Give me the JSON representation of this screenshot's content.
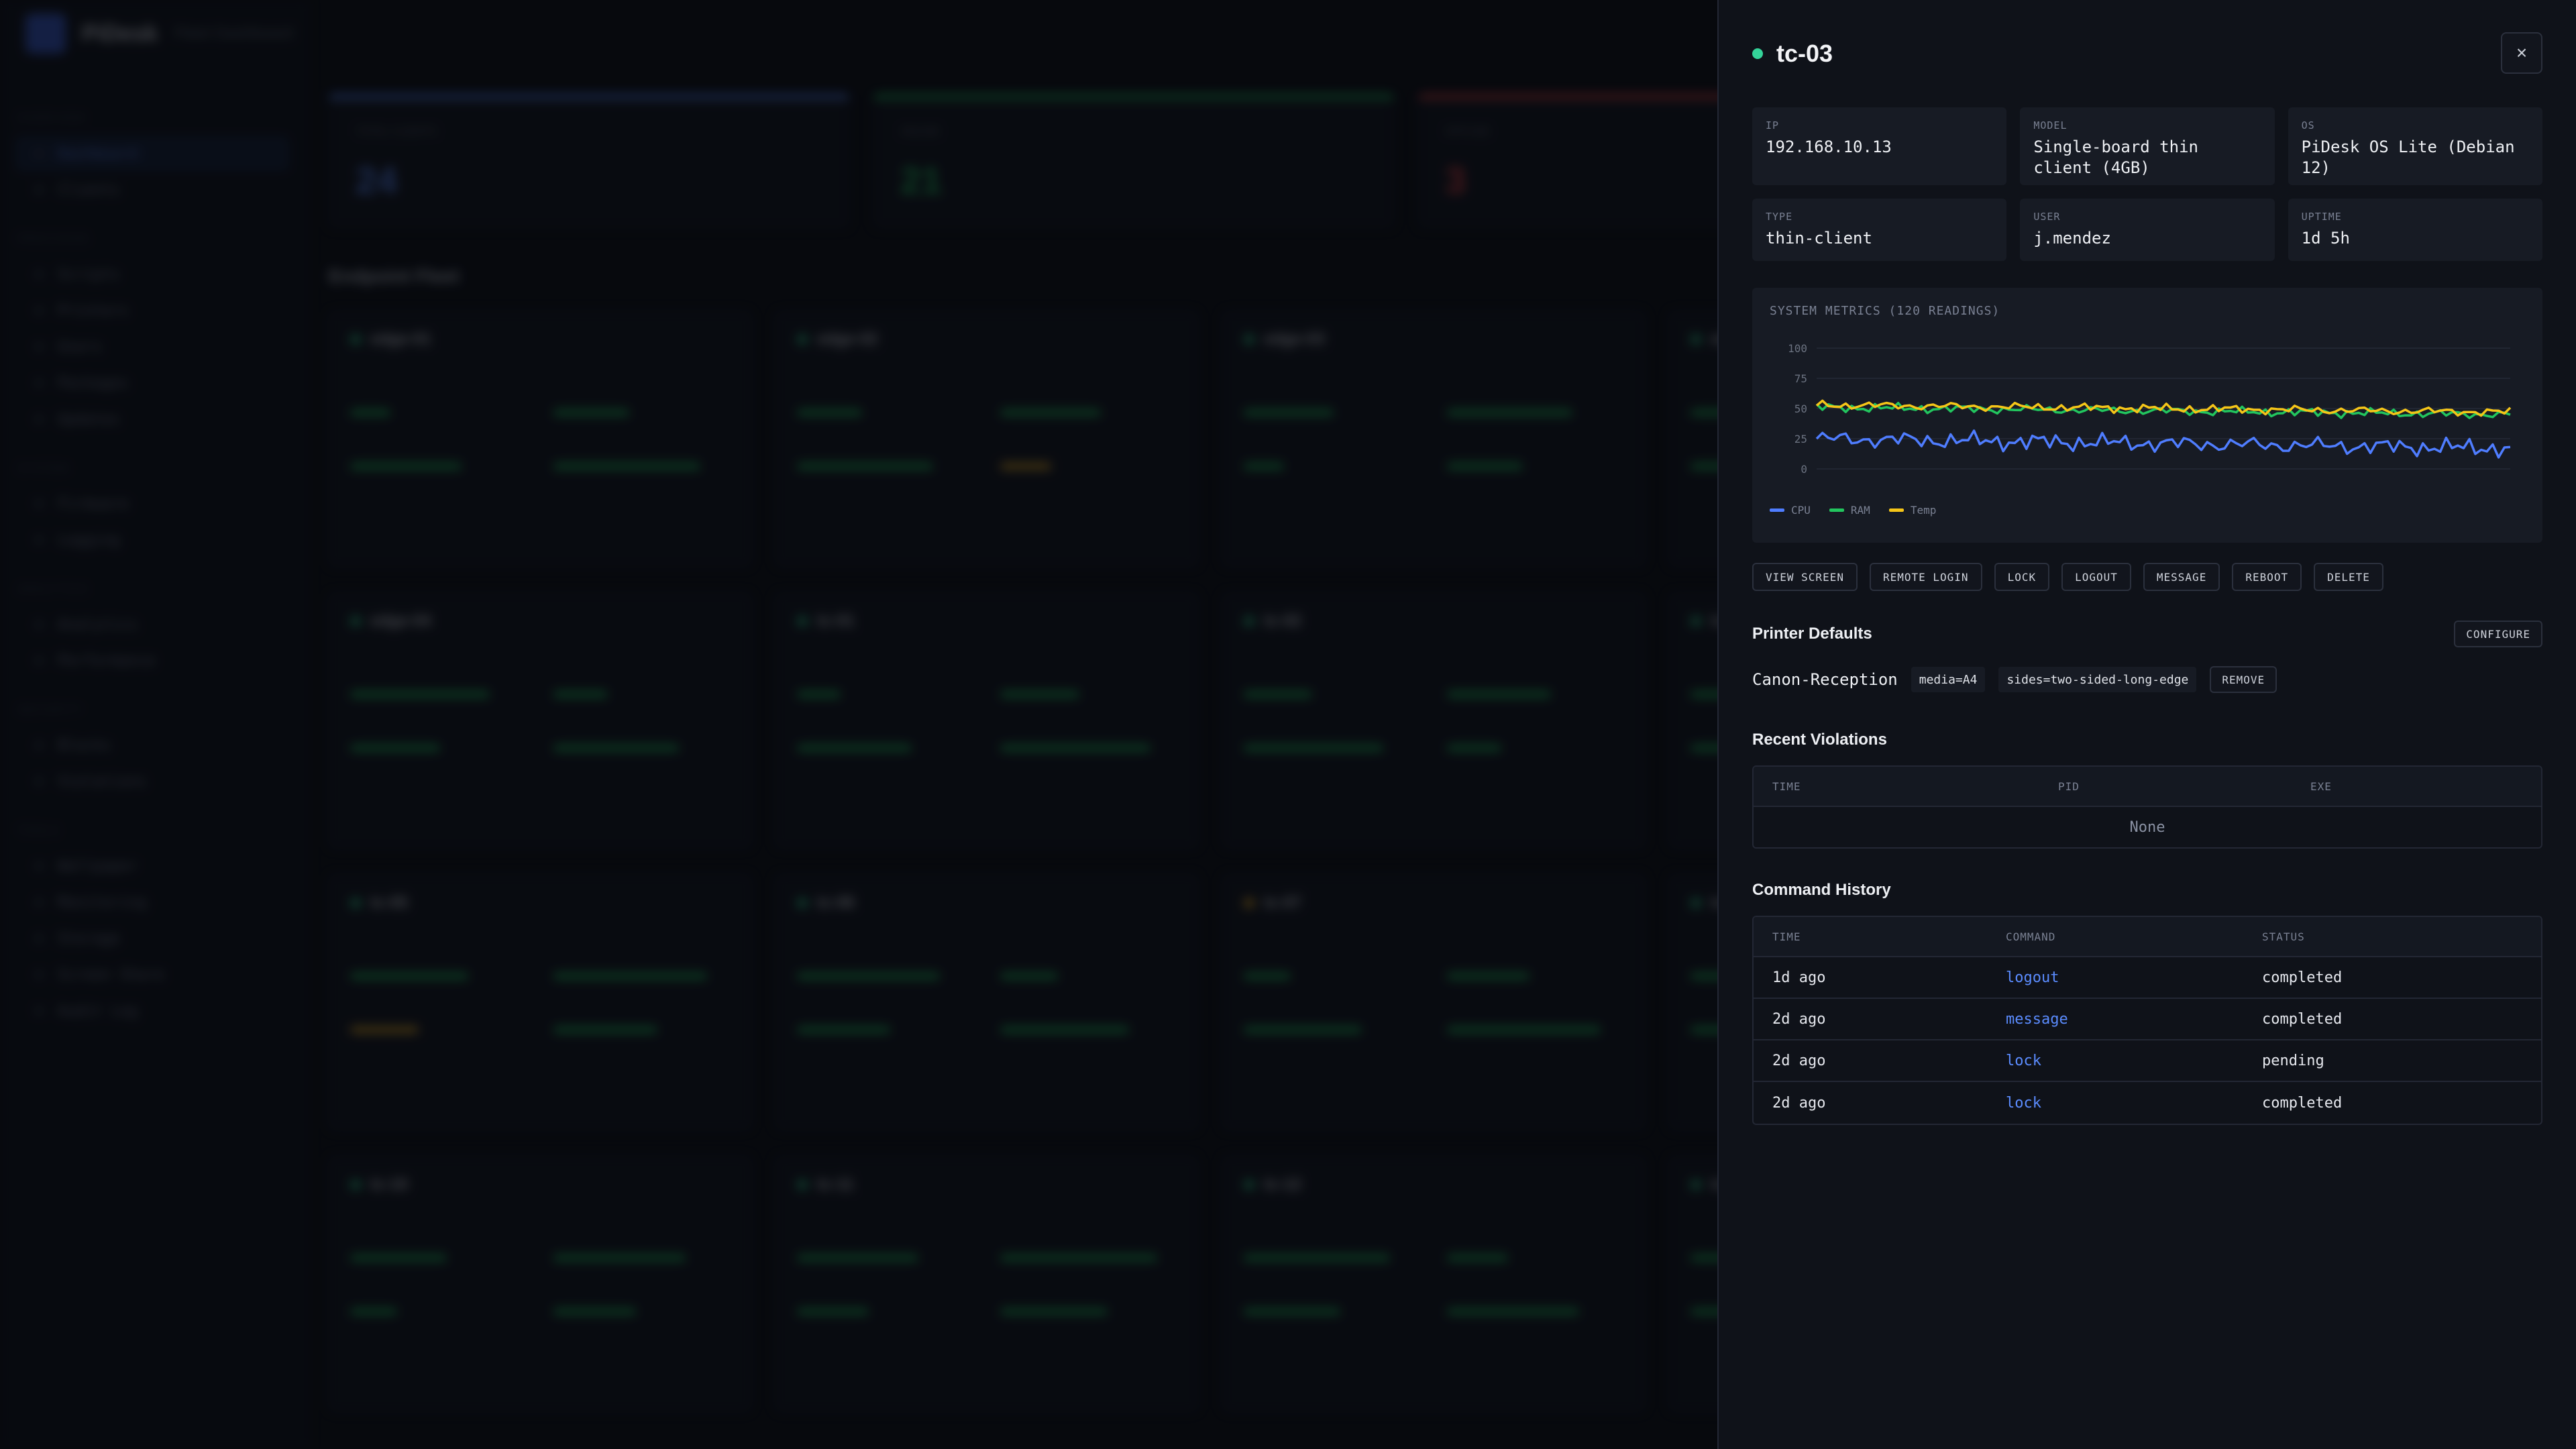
{
  "app": {
    "name": "PiDesk",
    "subtitle": "Fleet Dashboard"
  },
  "background": {
    "nav_sections": [
      {
        "title": "Overview",
        "items": [
          "Dashboard",
          "Clients"
        ]
      },
      {
        "title": "Provision",
        "items": [
          "Scripts",
          "Printers",
          "Users",
          "Packages",
          "Updates"
        ]
      },
      {
        "title": "System",
        "items": [
          "Firmware",
          "Logging"
        ]
      },
      {
        "title": "Analytics",
        "items": [
          "Analytics",
          "Performance"
        ]
      },
      {
        "title": "Security",
        "items": [
          "Blocks",
          "Violations"
        ]
      },
      {
        "title": "Tools",
        "items": [
          "Wallpaper",
          "Monitoring",
          "Storage",
          "Screen Share",
          "Audit Log"
        ]
      }
    ],
    "stats": [
      {
        "label": "TOTAL CLIENTS",
        "value": "24",
        "color": "#5b8cff"
      },
      {
        "label": "ONLINE",
        "value": "21",
        "color": "#22c55e"
      },
      {
        "label": "OFFLINE",
        "value": "3",
        "color": "#ef4444"
      }
    ],
    "fleet_heading": "Endpoint Fleet",
    "cards": [
      "edge-01",
      "edge-02",
      "edge-03",
      "edge-04",
      "edge-04",
      "tc-01",
      "tc-02",
      "tc-03",
      "tc-05",
      "tc-06",
      "tc-07",
      "tc-08",
      "tc-10",
      "tc-11",
      "tc-12",
      "tc-13"
    ]
  },
  "panel": {
    "title": "tc-03",
    "status_color": "#34d399",
    "close_label": "×",
    "info": [
      {
        "label": "IP",
        "value": "192.168.10.13"
      },
      {
        "label": "MODEL",
        "value": "Single-board thin client (4GB)"
      },
      {
        "label": "OS",
        "value": "PiDesk OS Lite (Debian 12)"
      },
      {
        "label": "TYPE",
        "value": "thin-client"
      },
      {
        "label": "USER",
        "value": "j.mendez"
      },
      {
        "label": "UPTIME",
        "value": "1d 5h"
      }
    ],
    "metrics_title": "SYSTEM METRICS (120 READINGS)",
    "actions": [
      "VIEW SCREEN",
      "REMOTE LOGIN",
      "LOCK",
      "LOGOUT",
      "MESSAGE",
      "REBOOT",
      "DELETE"
    ],
    "printer_section": {
      "title": "Printer Defaults",
      "configure_label": "CONFIGURE",
      "printer_name": "Canon-Reception",
      "options": [
        "media=A4",
        "sides=two-sided-long-edge"
      ],
      "remove_label": "REMOVE"
    },
    "violations": {
      "title": "Recent Violations",
      "columns": [
        "TIME",
        "PID",
        "EXE"
      ],
      "empty": "None"
    },
    "history": {
      "title": "Command History",
      "columns": [
        "TIME",
        "COMMAND",
        "STATUS"
      ],
      "rows": [
        {
          "time": "1d ago",
          "command": "logout",
          "status": "completed"
        },
        {
          "time": "2d ago",
          "command": "message",
          "status": "completed"
        },
        {
          "time": "2d ago",
          "command": "lock",
          "status": "pending"
        },
        {
          "time": "2d ago",
          "command": "lock",
          "status": "completed"
        }
      ]
    }
  },
  "chart_data": {
    "type": "line",
    "title": "SYSTEM METRICS (120 READINGS)",
    "ylim": [
      0,
      100
    ],
    "yticks": [
      100,
      75,
      50,
      25,
      0
    ],
    "series": [
      {
        "name": "CPU",
        "color": "#4f7dff",
        "base": 25,
        "amp": 6,
        "trend": -8
      },
      {
        "name": "RAM",
        "color": "#22c55e",
        "base": 51,
        "amp": 3,
        "trend": -6
      },
      {
        "name": "Temp",
        "color": "#f5c518",
        "base": 53,
        "amp": 3,
        "trend": -6
      }
    ],
    "n": 120
  }
}
